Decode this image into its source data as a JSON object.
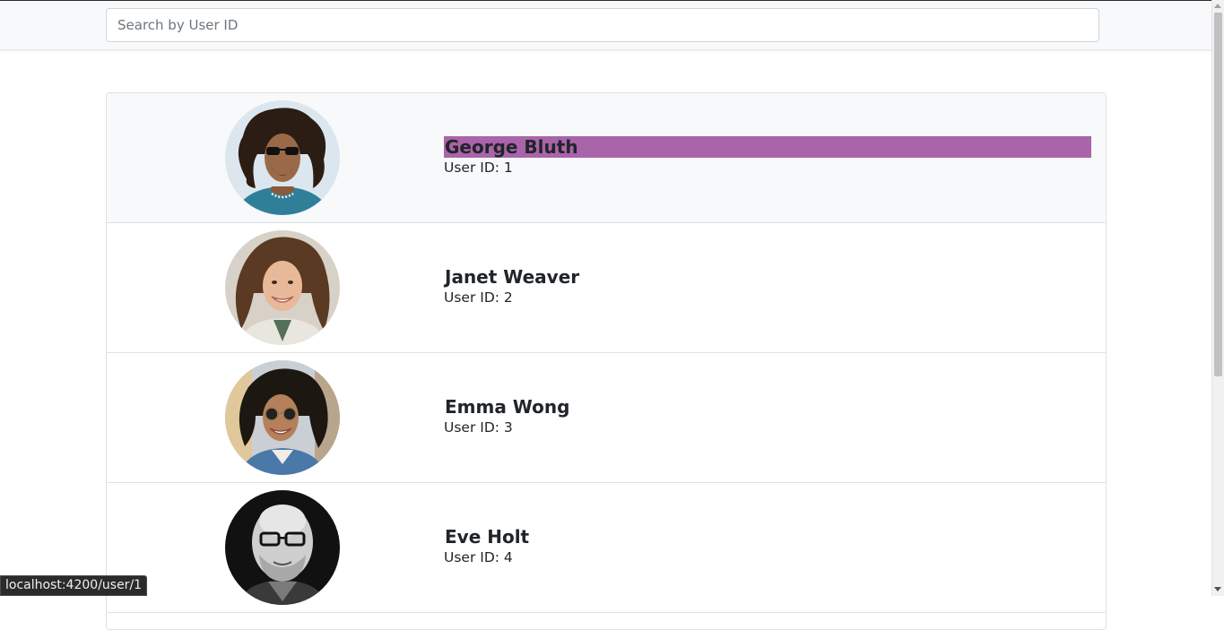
{
  "search": {
    "placeholder": "Search by User ID",
    "value": ""
  },
  "users": [
    {
      "name": "George Bluth",
      "id_label": "User ID: 1",
      "selected": true,
      "avatar": "man-curly-hair-sunglasses"
    },
    {
      "name": "Janet Weaver",
      "id_label": "User ID: 2",
      "selected": false,
      "avatar": "woman-curly-hair-smiling"
    },
    {
      "name": "Emma Wong",
      "id_label": "User ID: 3",
      "selected": false,
      "avatar": "woman-afro-sunglasses"
    },
    {
      "name": "Eve Holt",
      "id_label": "User ID: 4",
      "selected": false,
      "avatar": "man-bald-glasses-grayscale"
    }
  ],
  "status_bar": {
    "url": "localhost:4200/user/1"
  },
  "colors": {
    "highlight": "#aa64aa",
    "selected_row": "#f8f9fa",
    "border": "#dee2e6"
  }
}
